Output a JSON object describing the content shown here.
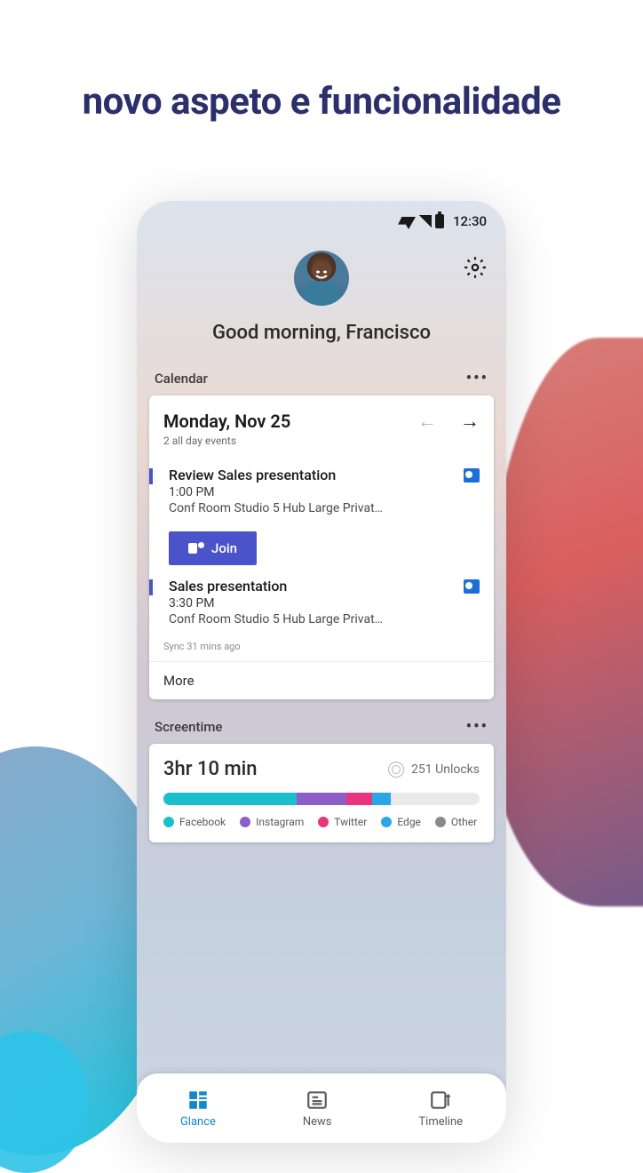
{
  "headline": "novo aspeto e funcionalidade",
  "status": {
    "time": "12:30"
  },
  "greeting": "Good morning, Francisco",
  "calendar": {
    "section_title": "Calendar",
    "date": "Monday, Nov 25",
    "subtitle": "2 all day events",
    "events": [
      {
        "title": "Review Sales presentation",
        "time": "1:00 PM",
        "location": "Conf Room Studio 5 Hub Large Privat…"
      },
      {
        "title": "Sales presentation",
        "time": "3:30 PM",
        "location": "Conf Room Studio 5 Hub Large Privat…"
      }
    ],
    "join_label": "Join",
    "sync_text": "Sync 31 mins ago",
    "more_label": "More"
  },
  "screentime": {
    "section_title": "Screentime",
    "total": "3hr 10 min",
    "unlocks": "251 Unlocks",
    "segments": [
      {
        "name": "Facebook",
        "color": "#1bbfcb",
        "pct": 42
      },
      {
        "name": "Instagram",
        "color": "#8c5fc7",
        "pct": 16
      },
      {
        "name": "Twitter",
        "color": "#e8357e",
        "pct": 8
      },
      {
        "name": "Edge",
        "color": "#2aa6e8",
        "pct": 6
      },
      {
        "name": "Other",
        "color": "#8a8a8a",
        "pct": 0
      }
    ]
  },
  "nav": {
    "glance": "Glance",
    "news": "News",
    "timeline": "Timeline"
  }
}
